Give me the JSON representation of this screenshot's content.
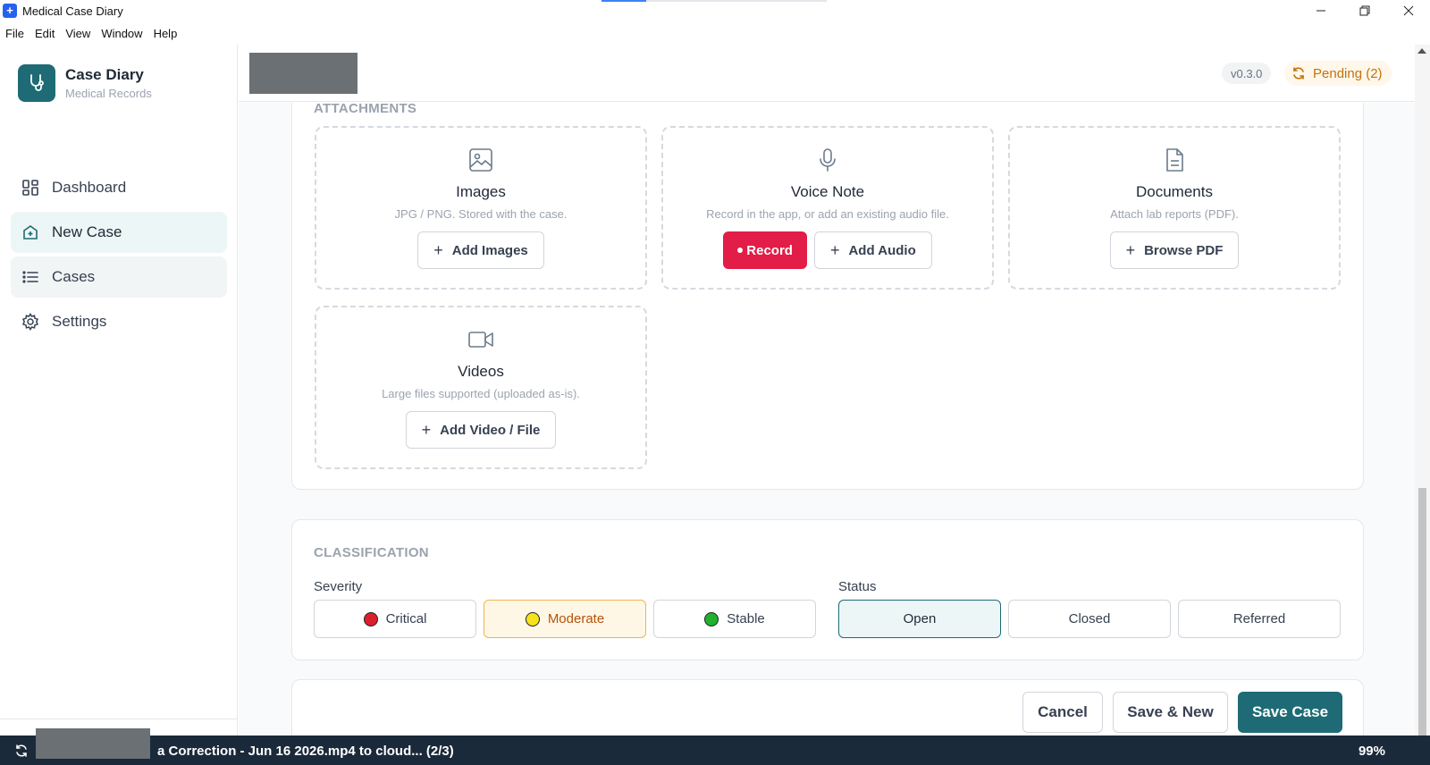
{
  "window": {
    "title": "Medical Case Diary",
    "controls": {
      "minimize": "—",
      "maximize": "❐",
      "close": "✕"
    }
  },
  "menu": [
    "File",
    "Edit",
    "View",
    "Window",
    "Help"
  ],
  "brand": {
    "title": "Case Diary",
    "subtitle": "Medical Records"
  },
  "sidebar": {
    "items": [
      {
        "label": "Dashboard",
        "icon": "dashboard-grid-icon",
        "state": "normal"
      },
      {
        "label": "New Case",
        "icon": "new-case-icon",
        "state": "active"
      },
      {
        "label": "Cases",
        "icon": "list-icon",
        "state": "hover"
      },
      {
        "label": "Settings",
        "icon": "gear-icon",
        "state": "normal"
      }
    ]
  },
  "header": {
    "version": "v0.3.0",
    "pending": "Pending (2)"
  },
  "attachments": {
    "section_label": "ATTACHMENTS",
    "images": {
      "title": "Images",
      "desc": "JPG / PNG. Stored with the case.",
      "button": "Add Images"
    },
    "voice": {
      "title": "Voice Note",
      "desc": "Record in the app, or add an existing audio file.",
      "record": "Record",
      "button": "Add Audio"
    },
    "documents": {
      "title": "Documents",
      "desc": "Attach lab reports (PDF).",
      "button": "Browse PDF"
    },
    "videos": {
      "title": "Videos",
      "desc": "Large files supported (uploaded as-is).",
      "button": "Add Video / File"
    }
  },
  "classification": {
    "section_label": "CLASSIFICATION",
    "severity_label": "Severity",
    "severity": [
      {
        "label": "Critical",
        "color": "#dc1f2e"
      },
      {
        "label": "Moderate",
        "color": "#f7e21b",
        "selected": true
      },
      {
        "label": "Stable",
        "color": "#22b02f"
      }
    ],
    "status_label": "Status",
    "status": [
      {
        "label": "Open",
        "selected": true
      },
      {
        "label": "Closed"
      },
      {
        "label": "Referred"
      }
    ]
  },
  "actions": {
    "cancel": "Cancel",
    "save_new": "Save & New",
    "save": "Save Case"
  },
  "statusbar": {
    "text": "a Correction - Jun 16 2026.mp4 to cloud... (2/3)",
    "percent": "99%"
  },
  "colors": {
    "accent": "#1e6b75",
    "record": "#e11d48",
    "pending": "#c2720d",
    "statusbar": "#1b2a3a"
  }
}
